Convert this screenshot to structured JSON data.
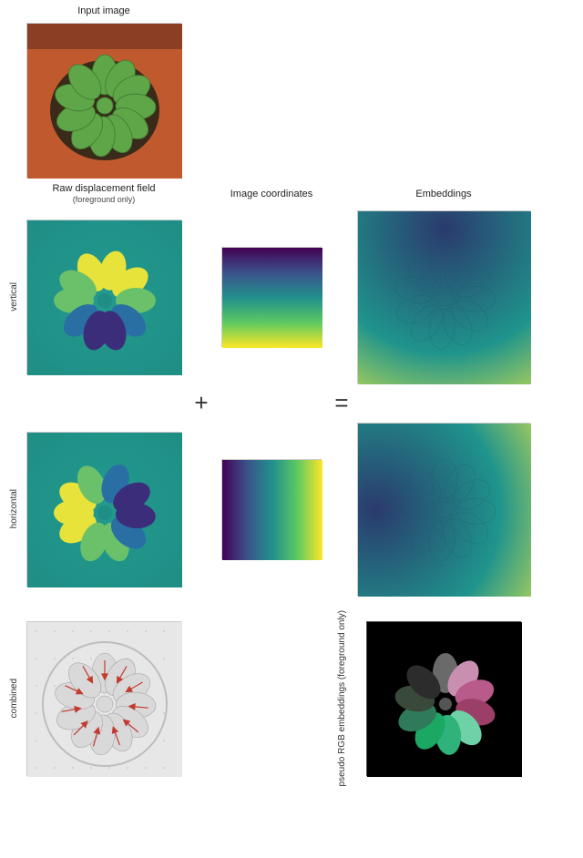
{
  "titles": {
    "input": "Input image",
    "raw": "Raw displacement field",
    "raw_sub": "(foreground only)",
    "coords": "Image coordinates",
    "emb": "Embeddings"
  },
  "rowlabels": {
    "vertical": "vertical",
    "horizontal": "horizontal",
    "combined": "combined",
    "pseudo": "pseudo RGB embeddings\n(foreground only)"
  },
  "ops": {
    "plus": "+",
    "eq": "="
  },
  "images": {
    "input_desc": "Top-down photo of a leafy plant in a pot on terracotta background",
    "raw_v_desc": "Teal field with plant silhouette; leaves colored by vertical displacement (yellow top, purple bottom)",
    "raw_h_desc": "Teal field with plant silhouette; leaves colored by horizontal displacement (yellow left, purple right)",
    "coord_v_desc": "Viridis vertical gradient (dark top → yellow bottom)",
    "coord_h_desc": "Viridis horizontal gradient (dark left → yellow right)",
    "emb_v_desc": "Smooth teal-yellow vertical embedding with faint plant outline",
    "emb_h_desc": "Smooth teal-yellow horizontal embedding with faint plant outline",
    "combined_desc": "Grayscale plant photo with red quiver arrows on leaves pointing toward centers",
    "pseudo_desc": "Black background; each leaf a distinct soft color blob"
  }
}
